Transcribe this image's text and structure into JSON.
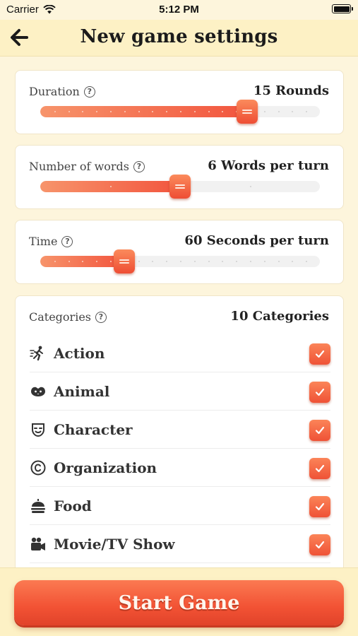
{
  "status": {
    "carrier": "Carrier",
    "time": "5:12 PM"
  },
  "nav": {
    "title": "New game settings",
    "back_icon": "arrow-left-icon"
  },
  "duration": {
    "label": "Duration",
    "value": "15 Rounds",
    "level": 0.74,
    "steps": 20
  },
  "words": {
    "label": "Number of words",
    "value": "6 Words per turn",
    "level": 0.5,
    "steps": 4
  },
  "time": {
    "label": "Time",
    "value": "60 Seconds per turn",
    "level": 0.3,
    "steps": 20
  },
  "categories": {
    "label": "Categories",
    "value": "10 Categories",
    "items": [
      {
        "name": "Action",
        "icon": "running-person-icon",
        "checked": true
      },
      {
        "name": "Animal",
        "icon": "paw-icon",
        "checked": true
      },
      {
        "name": "Character",
        "icon": "mask-icon",
        "checked": true
      },
      {
        "name": "Organization",
        "icon": "copyright-icon",
        "checked": true
      },
      {
        "name": "Food",
        "icon": "food-icon",
        "checked": true
      },
      {
        "name": "Movie/TV Show",
        "icon": "video-camera-icon",
        "checked": true
      }
    ]
  },
  "start_button": "Start Game",
  "colors": {
    "accent": "#f25234",
    "background": "#fdf5dc",
    "bar": "#fdf1c5"
  }
}
